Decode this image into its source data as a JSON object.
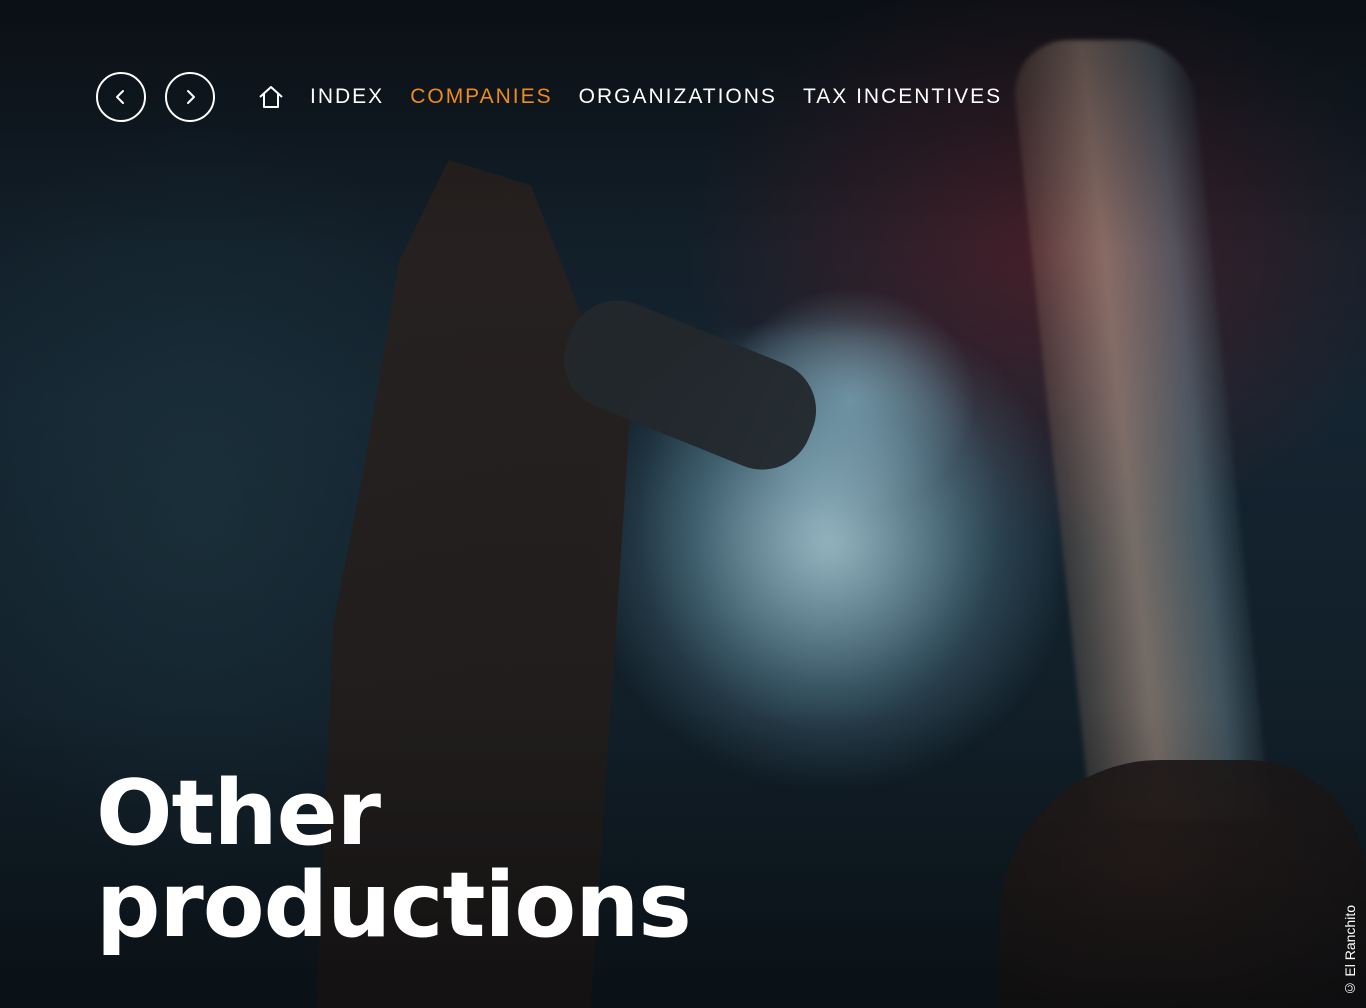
{
  "nav": {
    "back_label": "<",
    "forward_label": ">",
    "links": [
      {
        "label": "INDEX",
        "active": false
      },
      {
        "label": "COMPANIES",
        "active": true
      },
      {
        "label": "ORGANIZATIONS",
        "active": false
      },
      {
        "label": "TAX INCENTIVES",
        "active": false
      }
    ],
    "accent_color": "#f08a1c"
  },
  "hero": {
    "title_line1": "Other",
    "title_line2": "productions",
    "credit": "© El Ranchito"
  }
}
